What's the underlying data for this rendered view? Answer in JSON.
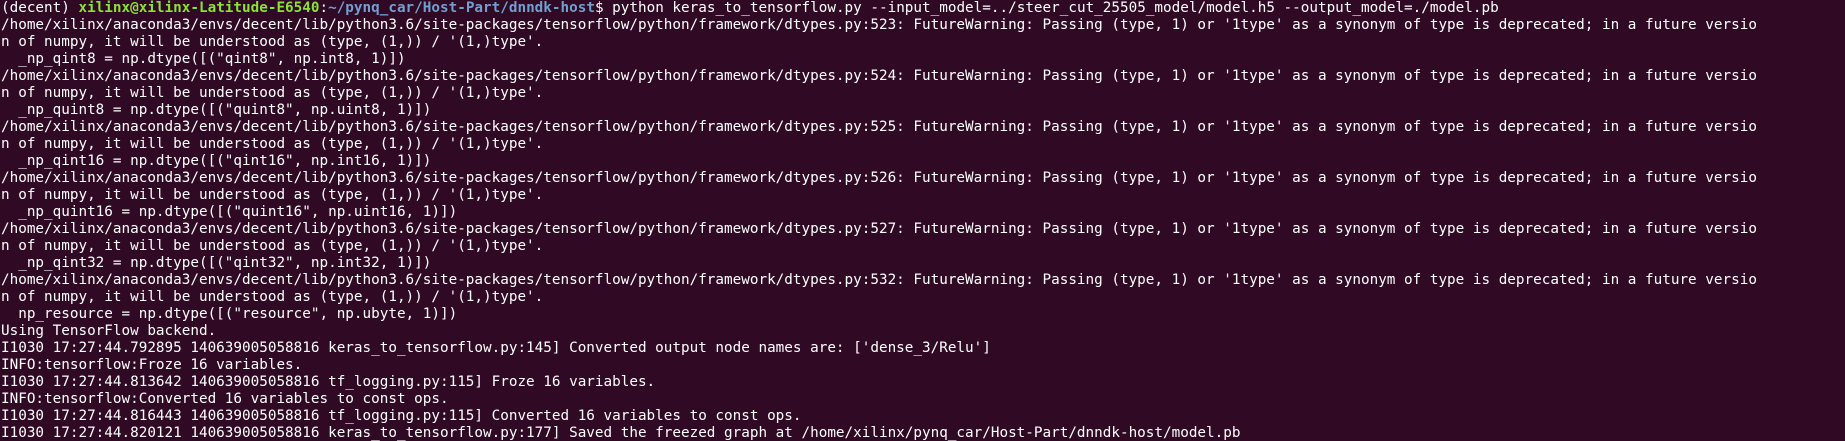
{
  "colors": {
    "background": "#300a24",
    "foreground": "#ffffff",
    "user_host": "#8ae234",
    "path": "#729fcf"
  },
  "prompt": {
    "env": "(decent) ",
    "user_host": "xilinx@xilinx-Latitude-E6540",
    "colon": ":",
    "path": "~/pynq_car/Host-Part/dnndk-host",
    "symbol": "$ ",
    "command": "python keras_to_tensorflow.py --input_model=../steer_cut_25505_model/model.h5 --output_model=./model.pb"
  },
  "output_lines": [
    "/home/xilinx/anaconda3/envs/decent/lib/python3.6/site-packages/tensorflow/python/framework/dtypes.py:523: FutureWarning: Passing (type, 1) or '1type' as a synonym of type is deprecated; in a future versio",
    "n of numpy, it will be understood as (type, (1,)) / '(1,)type'.",
    "  _np_qint8 = np.dtype([(\"qint8\", np.int8, 1)])",
    "/home/xilinx/anaconda3/envs/decent/lib/python3.6/site-packages/tensorflow/python/framework/dtypes.py:524: FutureWarning: Passing (type, 1) or '1type' as a synonym of type is deprecated; in a future versio",
    "n of numpy, it will be understood as (type, (1,)) / '(1,)type'.",
    "  _np_quint8 = np.dtype([(\"quint8\", np.uint8, 1)])",
    "/home/xilinx/anaconda3/envs/decent/lib/python3.6/site-packages/tensorflow/python/framework/dtypes.py:525: FutureWarning: Passing (type, 1) or '1type' as a synonym of type is deprecated; in a future versio",
    "n of numpy, it will be understood as (type, (1,)) / '(1,)type'.",
    "  _np_qint16 = np.dtype([(\"qint16\", np.int16, 1)])",
    "/home/xilinx/anaconda3/envs/decent/lib/python3.6/site-packages/tensorflow/python/framework/dtypes.py:526: FutureWarning: Passing (type, 1) or '1type' as a synonym of type is deprecated; in a future versio",
    "n of numpy, it will be understood as (type, (1,)) / '(1,)type'.",
    "  _np_quint16 = np.dtype([(\"quint16\", np.uint16, 1)])",
    "/home/xilinx/anaconda3/envs/decent/lib/python3.6/site-packages/tensorflow/python/framework/dtypes.py:527: FutureWarning: Passing (type, 1) or '1type' as a synonym of type is deprecated; in a future versio",
    "n of numpy, it will be understood as (type, (1,)) / '(1,)type'.",
    "  _np_qint32 = np.dtype([(\"qint32\", np.int32, 1)])",
    "/home/xilinx/anaconda3/envs/decent/lib/python3.6/site-packages/tensorflow/python/framework/dtypes.py:532: FutureWarning: Passing (type, 1) or '1type' as a synonym of type is deprecated; in a future versio",
    "n of numpy, it will be understood as (type, (1,)) / '(1,)type'.",
    "  np_resource = np.dtype([(\"resource\", np.ubyte, 1)])",
    "Using TensorFlow backend.",
    "I1030 17:27:44.792895 140639005058816 keras_to_tensorflow.py:145] Converted output node names are: ['dense_3/Relu']",
    "INFO:tensorflow:Froze 16 variables.",
    "I1030 17:27:44.813642 140639005058816 tf_logging.py:115] Froze 16 variables.",
    "INFO:tensorflow:Converted 16 variables to const ops.",
    "I1030 17:27:44.816443 140639005058816 tf_logging.py:115] Converted 16 variables to const ops.",
    "I1030 17:27:44.820121 140639005058816 keras_to_tensorflow.py:177] Saved the freezed graph at /home/xilinx/pynq_car/Host-Part/dnndk-host/model.pb"
  ]
}
